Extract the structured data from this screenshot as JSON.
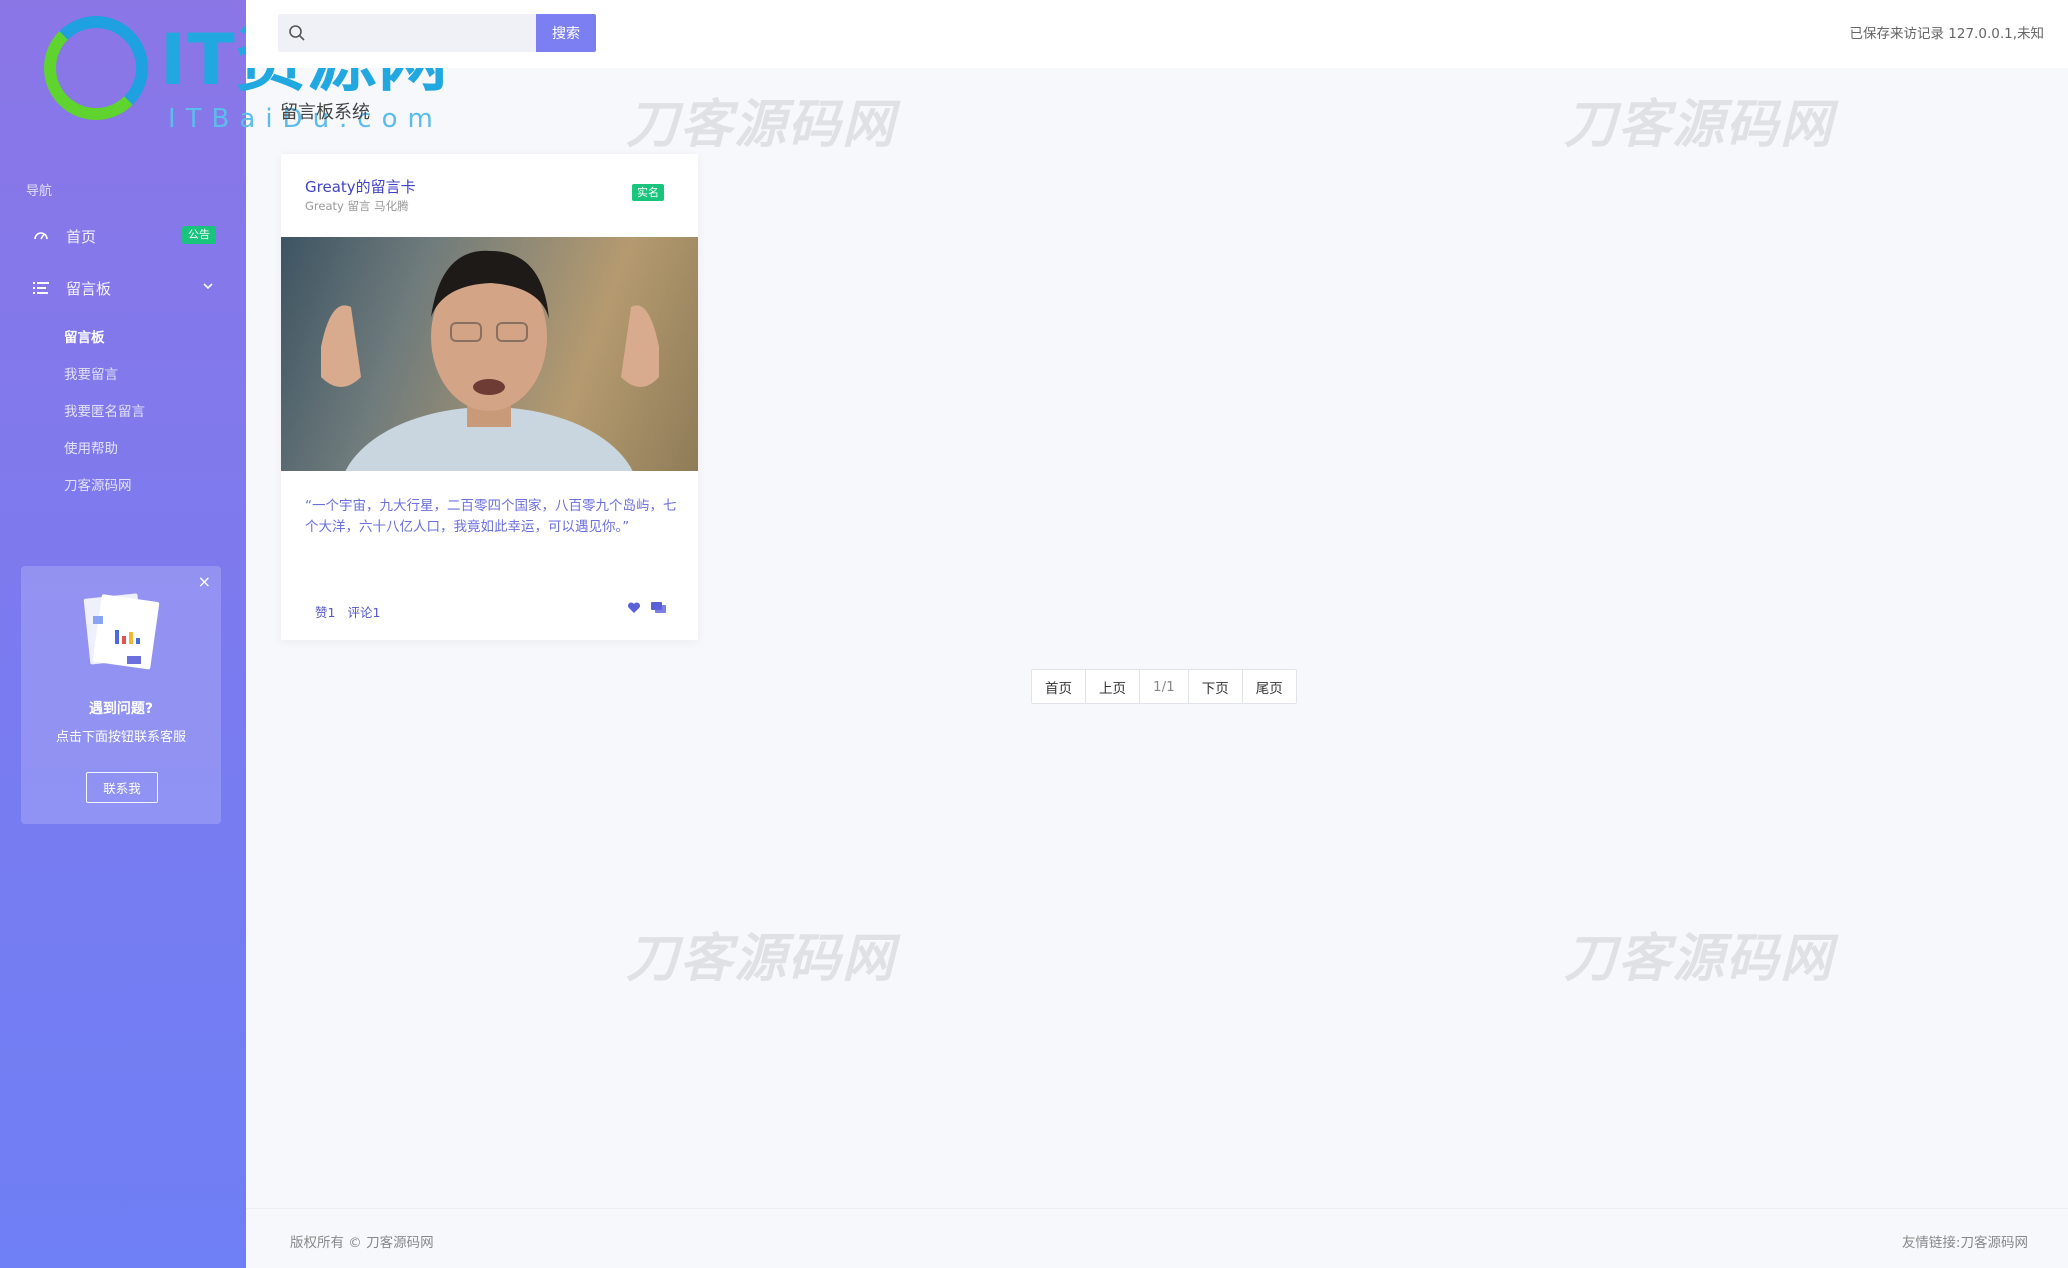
{
  "logo": {
    "main_text": "IT资源网",
    "sub_text": "ITBaiDu.com"
  },
  "sidebar": {
    "nav_title": "导航",
    "items": [
      {
        "label": "首页",
        "badge": "公告"
      },
      {
        "label": "留言板"
      }
    ],
    "sub_items": [
      {
        "label": "留言板",
        "active": true
      },
      {
        "label": "我要留言"
      },
      {
        "label": "我要匿名留言"
      },
      {
        "label": "使用帮助"
      },
      {
        "label": "刀客源码网"
      }
    ],
    "help_card": {
      "close": "×",
      "title": "遇到问题?",
      "desc": "点击下面按钮联系客服",
      "button": "联系我"
    }
  },
  "topbar": {
    "search_value": "",
    "search_button": "搜索",
    "visit_info": "已保存来访记录 127.0.0.1,未知"
  },
  "watermark": "刀客源码网",
  "main": {
    "heading": "留言板系统",
    "card": {
      "title": "Greaty的留言卡",
      "subtitle": "Greaty 留言 马化腾",
      "badge": "实名",
      "quote": "“一个宇宙，九大行星，二百零四个国家，八百零九个岛屿，七个大洋，六十八亿人口，我竟如此幸运，可以遇见你。”",
      "likes": "赞1",
      "comments": "评论1"
    },
    "pagination": [
      "首页",
      "上页",
      "1/1",
      "下页",
      "尾页"
    ]
  },
  "footer": {
    "copyright": "版权所有 © 刀客源码网",
    "links": "友情链接:刀客源码网"
  },
  "colors": {
    "accent": "#7c7ff2",
    "badge_green": "#19c47d",
    "sidebar_top": "#8b76e6",
    "sidebar_bottom": "#6f7ff5"
  }
}
